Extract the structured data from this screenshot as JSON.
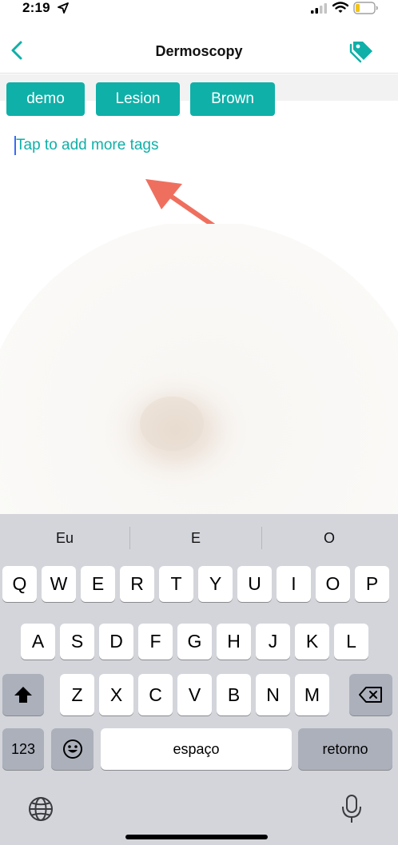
{
  "status_bar": {
    "time": "2:19",
    "icons": [
      "location-arrow-icon",
      "cellular-signal-icon",
      "wifi-icon",
      "battery-low-icon"
    ]
  },
  "nav": {
    "title": "Dermoscopy",
    "back_icon": "chevron-left-icon",
    "tags_icon": "tag-icon"
  },
  "tags": [
    {
      "label": "demo"
    },
    {
      "label": "Lesion"
    },
    {
      "label": "Brown"
    }
  ],
  "tag_input": {
    "placeholder": "Tap to add more tags",
    "value": ""
  },
  "colors": {
    "accent": "#0fb0a8",
    "annotation_arrow": "#ef6f5e",
    "keyboard_bg": "#d3d5db",
    "key_dark": "#abb0bb"
  },
  "keyboard": {
    "suggestions": [
      "Eu",
      "E",
      "O"
    ],
    "row1": [
      "Q",
      "W",
      "E",
      "R",
      "T",
      "Y",
      "U",
      "I",
      "O",
      "P"
    ],
    "row2": [
      "A",
      "S",
      "D",
      "F",
      "G",
      "H",
      "J",
      "K",
      "L"
    ],
    "row3": [
      "Z",
      "X",
      "C",
      "V",
      "B",
      "N",
      "M"
    ],
    "shift_icon": "shift-arrow-icon",
    "delete_icon": "backspace-icon",
    "numbers_label": "123",
    "emoji_icon": "emoji-icon",
    "space_label": "espaço",
    "return_label": "retorno",
    "globe_icon": "globe-icon",
    "mic_icon": "microphone-icon"
  }
}
